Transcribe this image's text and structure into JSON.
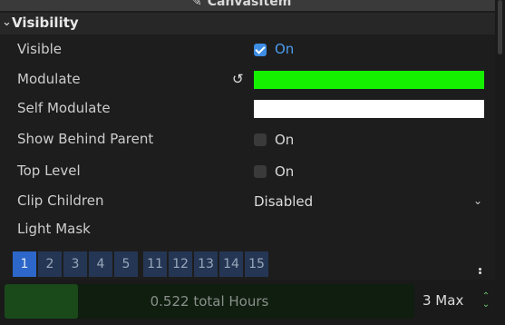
{
  "header": {
    "title": "CanvasItem",
    "icon": "pencil-icon"
  },
  "section": {
    "title": "Visibility",
    "expanded": true
  },
  "properties": {
    "visible": {
      "label": "Visible",
      "checked": true,
      "value_text": "On"
    },
    "modulate": {
      "label": "Modulate",
      "color": "#14f000",
      "revert_icon": "revert-icon"
    },
    "self_modulate": {
      "label": "Self Modulate",
      "color": "#ffffff"
    },
    "show_behind_parent": {
      "label": "Show Behind Parent",
      "checked": false,
      "value_text": "On"
    },
    "top_level": {
      "label": "Top Level",
      "checked": false,
      "value_text": "On"
    },
    "clip_children": {
      "label": "Clip Children",
      "value": "Disabled"
    },
    "light_mask": {
      "label": "Light Mask"
    }
  },
  "light_mask_layers": [
    "1",
    "2",
    "3",
    "4",
    "5",
    "11",
    "12",
    "13",
    "14",
    "15"
  ],
  "light_mask_active": "1",
  "footer": {
    "progress_text": "0.522 total Hours",
    "progress_fraction": 0.18,
    "spin_value": "3 Max"
  },
  "colors": {
    "accent_blue": "#3e8de4",
    "on_text_blue": "#4a9df0",
    "layer_active": "#2c67c9",
    "layer_inactive": "#253654",
    "progress_fill": "#1a4a1a",
    "spin_arrow_green": "#6fcf6f"
  }
}
